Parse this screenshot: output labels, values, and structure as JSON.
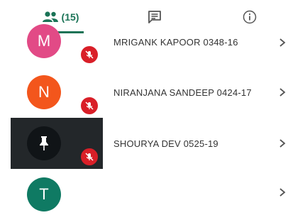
{
  "tabs": {
    "participants_count": "(15)",
    "active_color": "#1a7356",
    "items": [
      {
        "name": "participants",
        "icon": "people-icon"
      },
      {
        "name": "chat",
        "icon": "chat-icon"
      },
      {
        "name": "info",
        "icon": "info-icon"
      }
    ]
  },
  "participants": [
    {
      "initial": "M",
      "name": "MRIGANK KAPOOR 0348-16",
      "avatar_color": "#e24a86",
      "muted": true
    },
    {
      "initial": "N",
      "name": "NIRANJANA SANDEEP 0424-17",
      "avatar_color": "#f3561c",
      "muted": true
    },
    {
      "initial": "",
      "icon": "pin-icon",
      "name": "SHOURYA DEV 0525-19",
      "avatar_color": "#101417",
      "muted": true,
      "highlighted": true
    },
    {
      "initial": "T",
      "name": "",
      "avatar_color": "#0f7a63",
      "muted": false
    }
  ]
}
